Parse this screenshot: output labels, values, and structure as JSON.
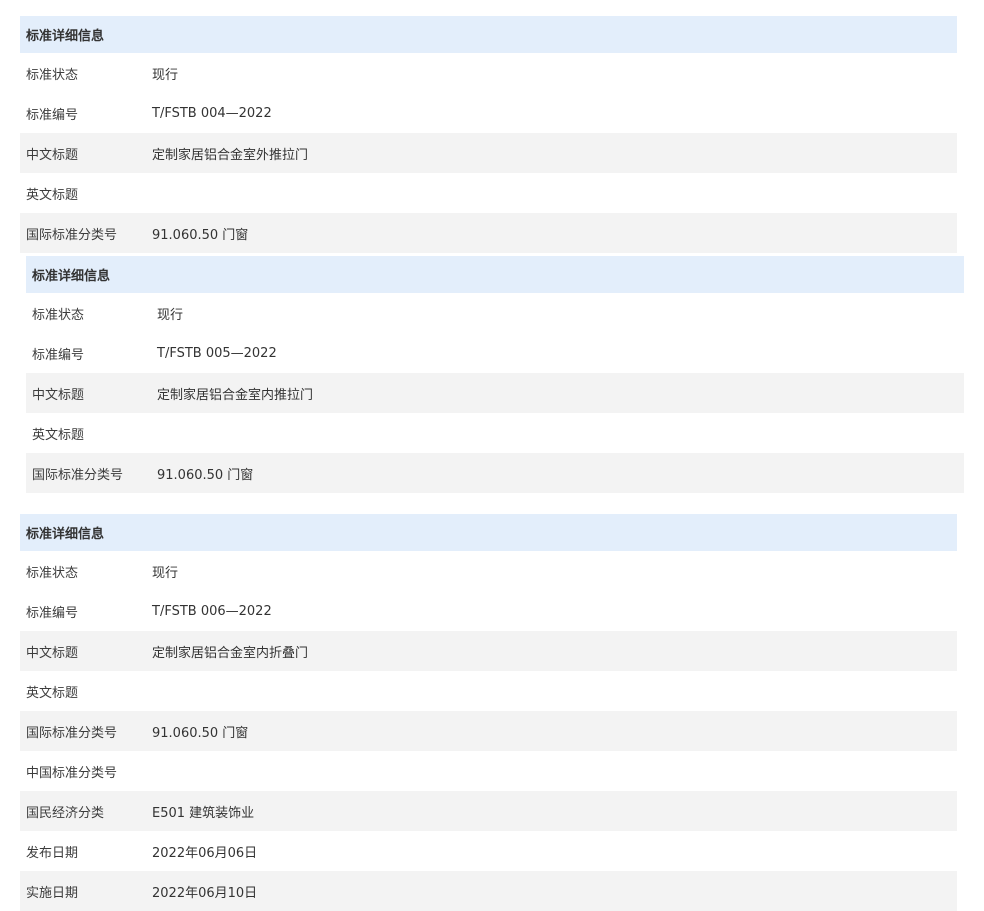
{
  "panels": [
    {
      "header": "标准详细信息",
      "rows": [
        {
          "label": "标准状态",
          "value": "现行"
        },
        {
          "label": "标准编号",
          "value": "T/FSTB 004—2022"
        },
        {
          "label": "中文标题",
          "value": "定制家居铝合金室外推拉门"
        },
        {
          "label": "英文标题",
          "value": ""
        },
        {
          "label": "国际标准分类号",
          "value": "91.060.50 门窗"
        }
      ]
    },
    {
      "header": "标准详细信息",
      "rows": [
        {
          "label": "标准状态",
          "value": "现行"
        },
        {
          "label": "标准编号",
          "value": "T/FSTB 005—2022"
        },
        {
          "label": "中文标题",
          "value": "定制家居铝合金室内推拉门"
        },
        {
          "label": "英文标题",
          "value": ""
        },
        {
          "label": "国际标准分类号",
          "value": "91.060.50 门窗"
        }
      ]
    },
    {
      "header": "标准详细信息",
      "rows": [
        {
          "label": "标准状态",
          "value": "现行"
        },
        {
          "label": "标准编号",
          "value": "T/FSTB 006—2022"
        },
        {
          "label": "中文标题",
          "value": "定制家居铝合金室内折叠门"
        },
        {
          "label": "英文标题",
          "value": ""
        },
        {
          "label": "国际标准分类号",
          "value": "91.060.50 门窗"
        },
        {
          "label": "中国标准分类号",
          "value": ""
        },
        {
          "label": "国民经济分类",
          "value": "E501 建筑装饰业"
        },
        {
          "label": "发布日期",
          "value": "2022年06月06日"
        },
        {
          "label": "实施日期",
          "value": "2022年06月10日"
        }
      ]
    }
  ]
}
